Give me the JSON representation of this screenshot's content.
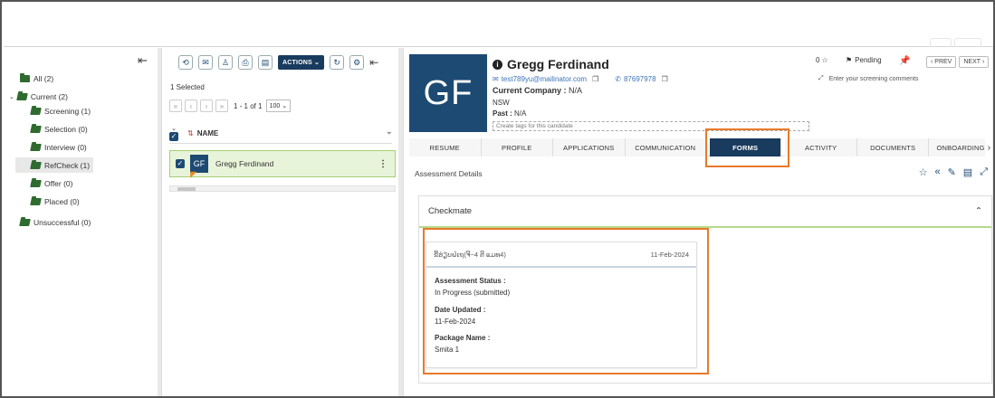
{
  "tree": {
    "items": [
      {
        "label": "All (2)",
        "level": 0
      },
      {
        "label": "Current (2)",
        "level": 0,
        "expanded": true
      },
      {
        "label": "Screening (1)",
        "level": 1
      },
      {
        "label": "Selection (0)",
        "level": 1
      },
      {
        "label": "Interview (0)",
        "level": 1
      },
      {
        "label": "RefCheck (1)",
        "level": 1,
        "selected": true
      },
      {
        "label": "Offer (0)",
        "level": 1
      },
      {
        "label": "Placed (0)",
        "level": 1
      },
      {
        "label": "Unsuccessful (0)",
        "level": 0
      }
    ]
  },
  "list": {
    "actions_label": "ACTIONS",
    "selected_text": "1 Selected",
    "pager_text": "1 - 1 of 1",
    "page_size": "100",
    "column_name": "NAME",
    "row": {
      "initials": "GF",
      "name": "Gregg Ferdinand"
    }
  },
  "candidate": {
    "initials": "GF",
    "name": "Gregg Ferdinand",
    "email": "test789yu@mailinator.com",
    "phone": "87697978",
    "company_label": "Current Company :",
    "company_value": "N/A",
    "state": "NSW",
    "past_label": "Past :",
    "past_value": "N/A",
    "tags_placeholder": "Create tags for this candidate",
    "rating": "0",
    "status": "Pending",
    "prev_label": "PREV",
    "next_label": "NEXT",
    "screening_placeholder": "Enter your screening comments"
  },
  "tabs": [
    "RESUME",
    "PROFILE",
    "APPLICATIONS",
    "COMMUNICATION",
    "FORMS",
    "ACTIVITY",
    "DOCUMENTS",
    "ONBOARDING"
  ],
  "active_tab": "FORMS",
  "assessment": {
    "section_title": "Assessment Details",
    "card_title": "Checkmate",
    "item_title": "ຂີ້ຮ່ຽບຝ່ເຖ(ຈີ−4 ຕີ ແມທ4)",
    "item_date": "11-Feb-2024",
    "fields": [
      {
        "label": "Assessment Status :",
        "value": "In Progress (submitted)"
      },
      {
        "label": "Date Updated :",
        "value": "11-Feb-2024"
      },
      {
        "label": "Package Name :",
        "value": "Smita 1"
      }
    ]
  },
  "colors": {
    "navy": "#183b5e",
    "highlight": "#e8792a",
    "selected_row": "#e8f4d9",
    "folder": "#2f6b2f"
  }
}
